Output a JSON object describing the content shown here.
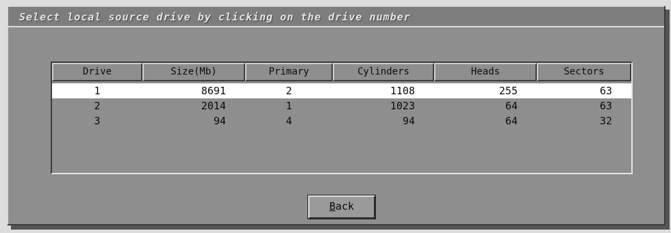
{
  "dialog": {
    "title": "Select local source drive by clicking on the drive number"
  },
  "table": {
    "columns": [
      "Drive",
      "Size(Mb)",
      "Primary",
      "Cylinders",
      "Heads",
      "Sectors"
    ],
    "rows": [
      {
        "drive": "1",
        "size": "8691",
        "primary": "2",
        "cylinders": "1108",
        "heads": "255",
        "sectors": "63",
        "selected": true
      },
      {
        "drive": "2",
        "size": "2014",
        "primary": "1",
        "cylinders": "1023",
        "heads": "64",
        "sectors": "63",
        "selected": false
      },
      {
        "drive": "3",
        "size": "94",
        "primary": "4",
        "cylinders": "94",
        "heads": "64",
        "sectors": "32",
        "selected": false
      }
    ]
  },
  "buttons": {
    "back_mnemonic": "B",
    "back_rest": "ack"
  }
}
